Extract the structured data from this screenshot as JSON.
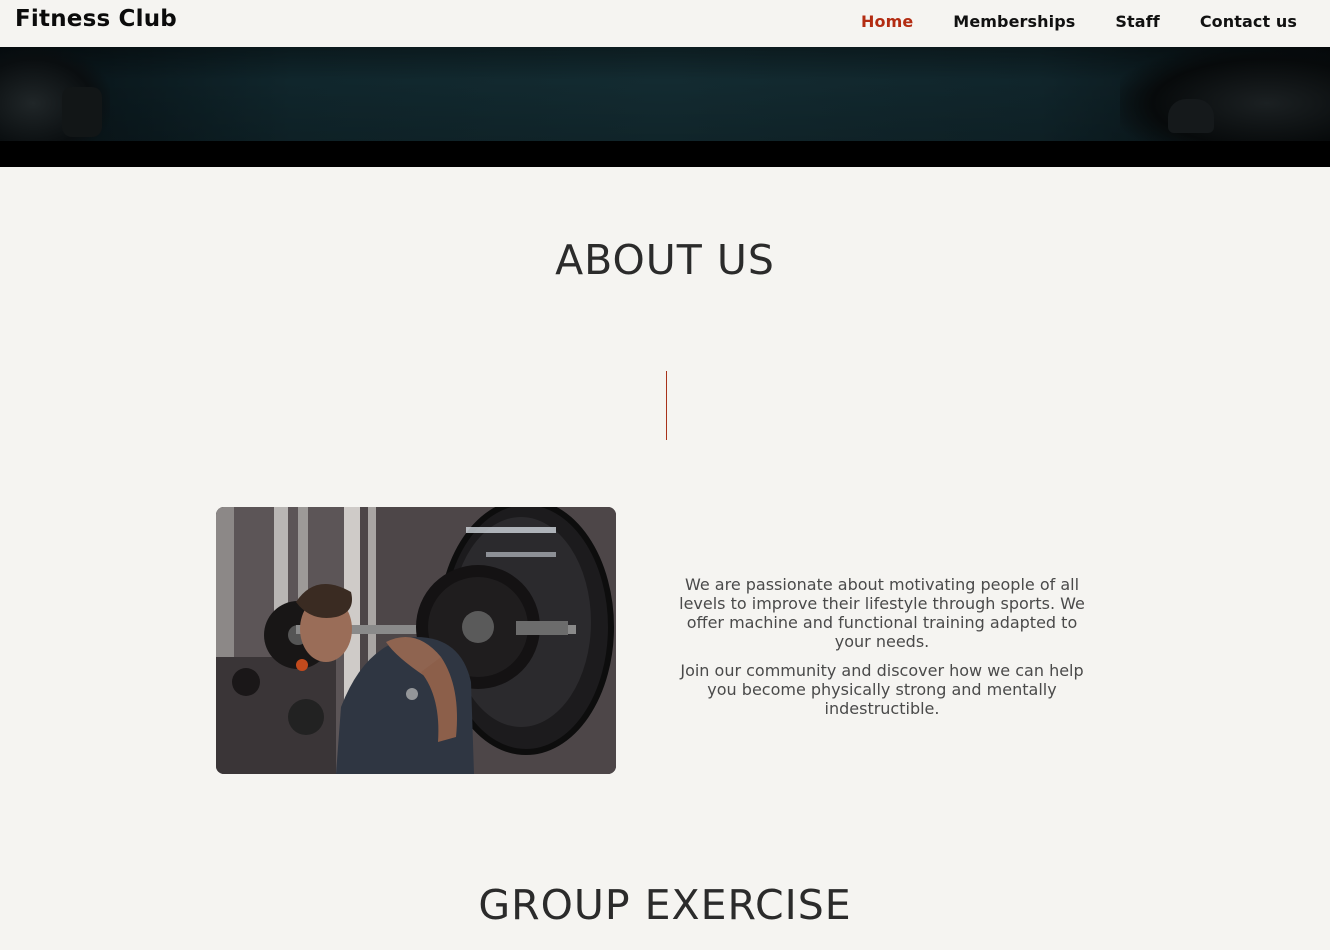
{
  "header": {
    "brand": "Fitness Club",
    "nav": [
      {
        "label": "Home",
        "active": true
      },
      {
        "label": "Memberships",
        "active": false
      },
      {
        "label": "Staff",
        "active": false
      },
      {
        "label": "Contact us",
        "active": false
      }
    ]
  },
  "about": {
    "title": "ABOUT US",
    "paragraphs": [
      "We are passionate about motivating people of all levels to improve their lifestyle through sports. We offer machine and functional training adapted to your needs.",
      "Join our community and discover how we can help you become physically strong and mentally indestructible."
    ]
  },
  "group_exercise": {
    "title": "GROUP EXERCISE"
  },
  "colors": {
    "accent": "#b32c12",
    "background": "#f5f4f1",
    "text_dark": "#2b2b2b",
    "text_body": "#4a4a4a"
  }
}
